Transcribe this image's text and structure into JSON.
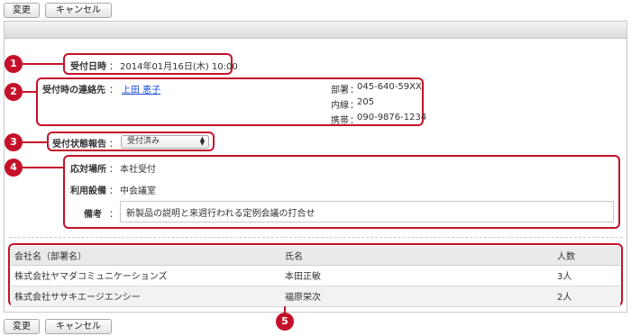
{
  "toolbar": {
    "change_label": "変更",
    "cancel_label": "キャンセル"
  },
  "reception": {
    "datetime_label": "受付日時",
    "separator": "：",
    "datetime_value": "2014年01月16日(木) 10:00",
    "contact_label": "受付時の連絡先",
    "contact_name": "上田 恵子",
    "dept_label": "部署",
    "dept_value": "045-640-59XX",
    "ext_label": "内線",
    "ext_value": "205",
    "mobile_label": "携帯",
    "mobile_value": "090-9876-1234",
    "status_label": "受付状態報告",
    "status_value": "受付済み",
    "place_label": "応対場所",
    "place_value": "本社受付",
    "facility_label": "利用設備",
    "facility_value": "中会議室",
    "note_label": "備考",
    "note_value": "新製品の説明と来週行われる定例会議の打合せ"
  },
  "visitors": {
    "columns": [
      "会社名（部署名）",
      "氏名",
      "人数"
    ],
    "rows": [
      [
        "株式会社ヤマダコミュニケーションズ",
        "本田正敏",
        "3人"
      ],
      [
        "株式会社ササキエージエンシー",
        "福原栄次",
        "2人"
      ]
    ]
  },
  "badges": [
    "1",
    "2",
    "3",
    "4",
    "5"
  ],
  "colors": {
    "annotation": "#c4112a",
    "link": "#1a4ed8"
  }
}
